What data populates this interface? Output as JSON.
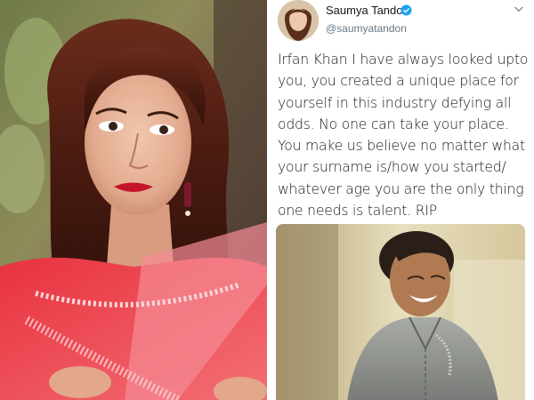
{
  "tweet": {
    "display_name": "Saumya Tandon",
    "handle": "@saumyatandon",
    "text": "Irfan Khan I have always looked upto you, you created a unique place for yourself in this industry defying all odds. No one can take your place. You make us believe no matter what your surname is/how you started/ whatever age you are the only thing one needs is talent. RIP",
    "verified_color": "#1da1f2"
  },
  "icons": {
    "verified": "verified-badge-icon",
    "menu": "chevron-down-icon"
  }
}
